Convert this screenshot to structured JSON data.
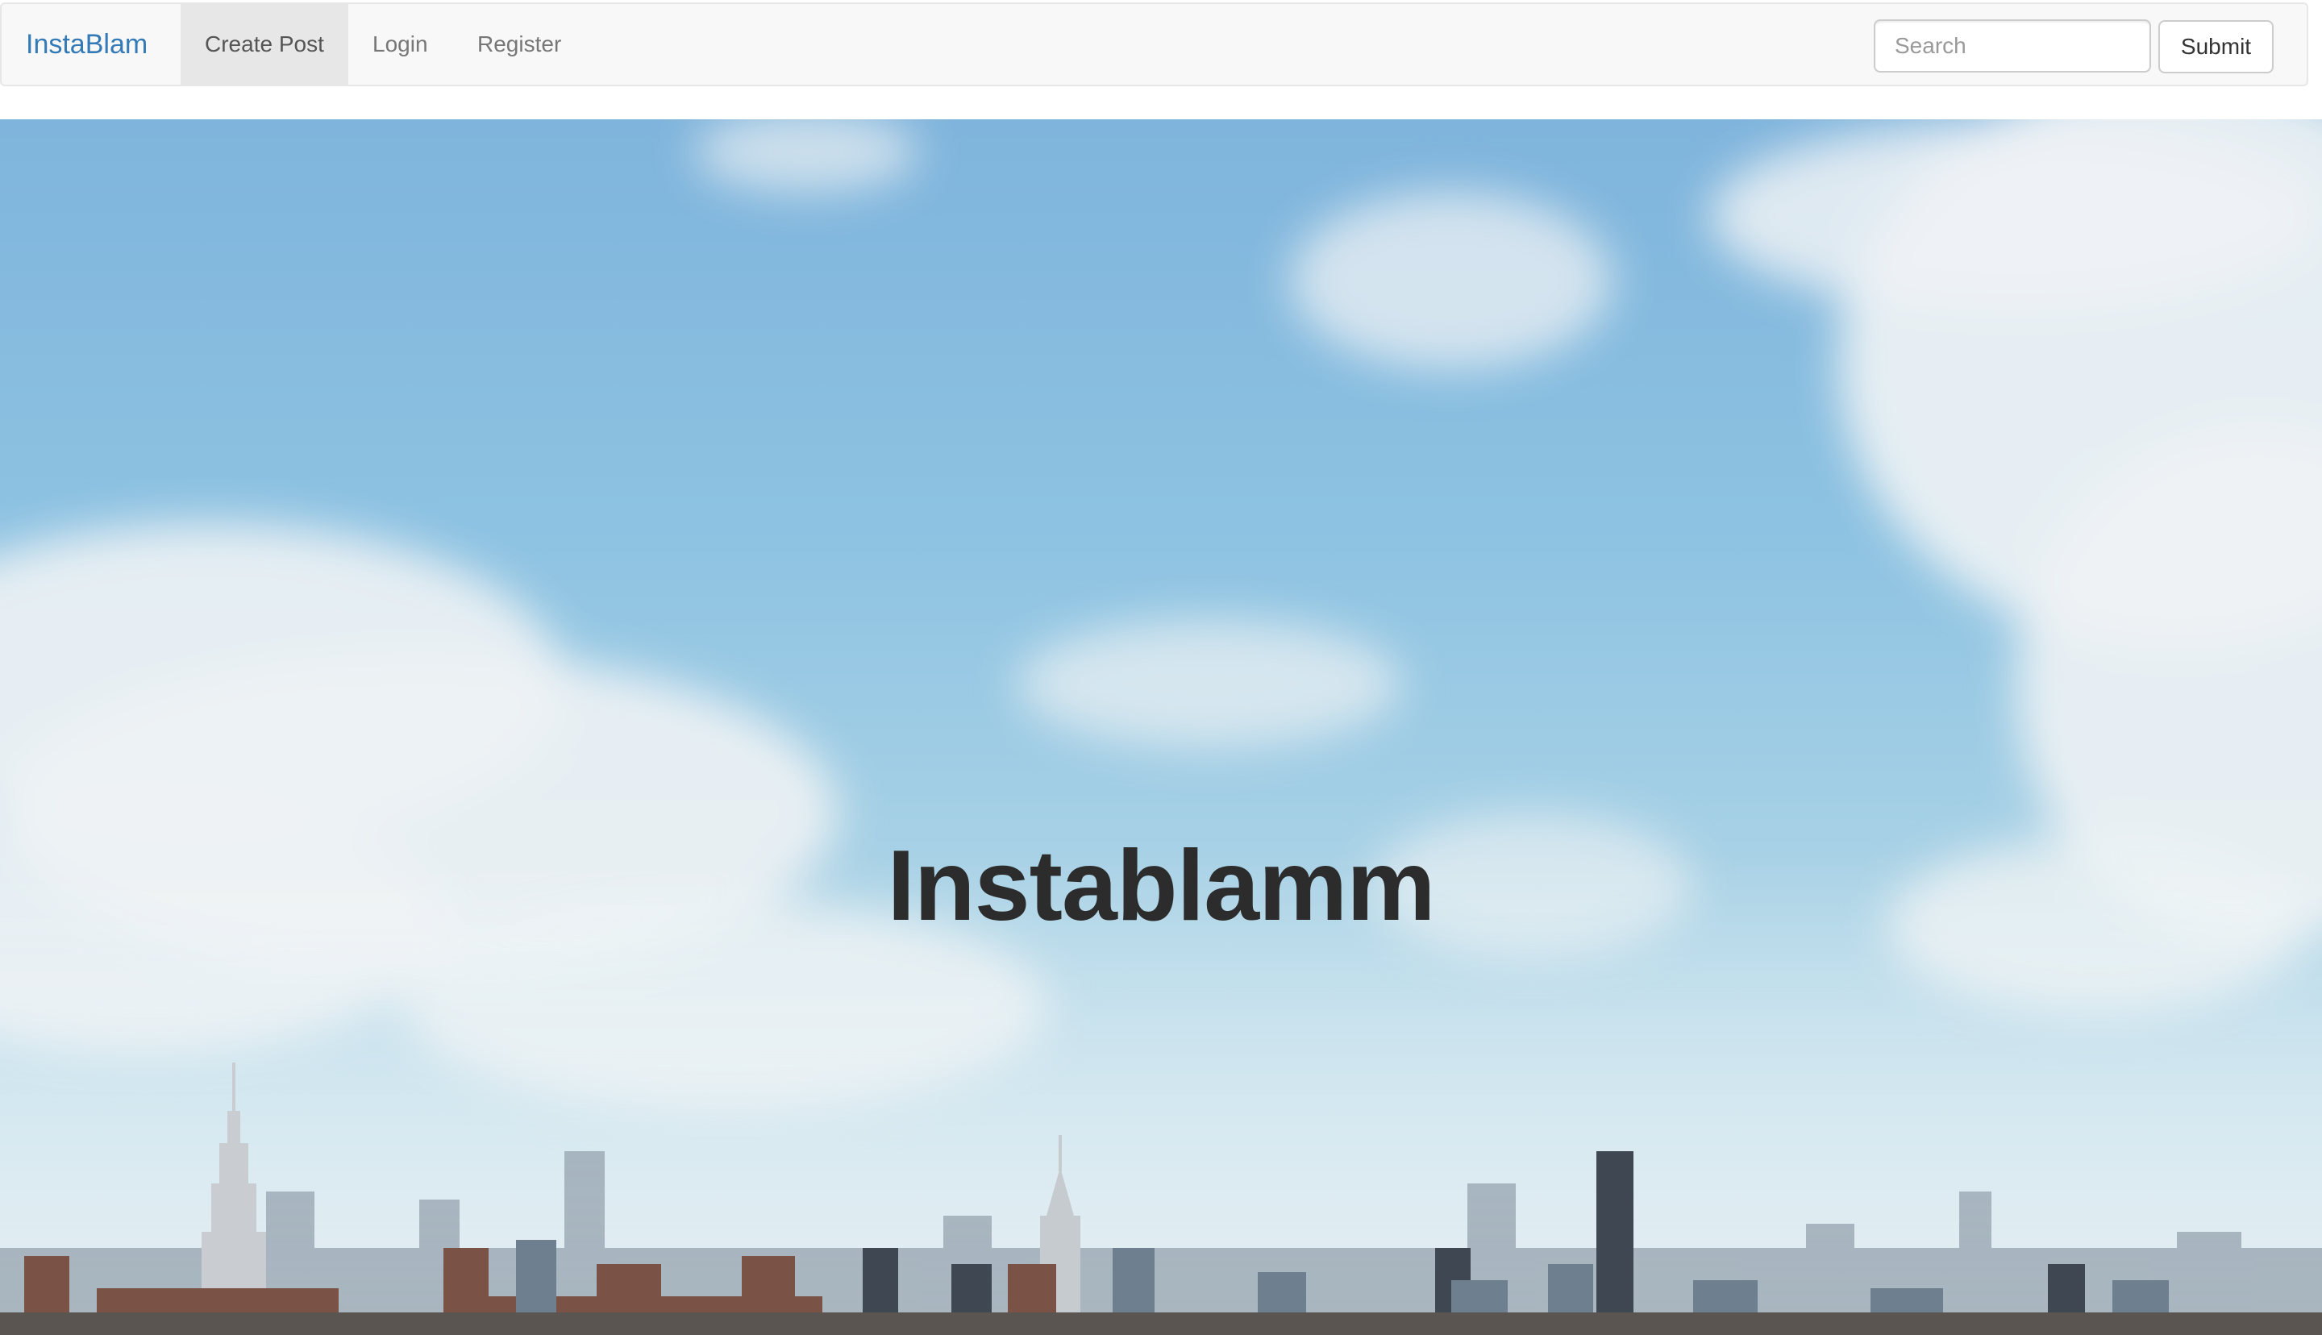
{
  "navbar": {
    "brand": "InstaBlam",
    "items": [
      {
        "label": "Create Post",
        "active": true
      },
      {
        "label": "Login",
        "active": false
      },
      {
        "label": "Register",
        "active": false
      }
    ],
    "search": {
      "placeholder": "Search",
      "value": ""
    },
    "submit_label": "Submit"
  },
  "hero": {
    "title": "Instablamm",
    "background": "city-skyline-photo"
  },
  "colors": {
    "brand": "#337ab7",
    "navbar_bg": "#f8f8f8",
    "active_item_bg": "#e7e7e7",
    "title": "#2c2c2c",
    "sky": "#8ec3e2"
  }
}
